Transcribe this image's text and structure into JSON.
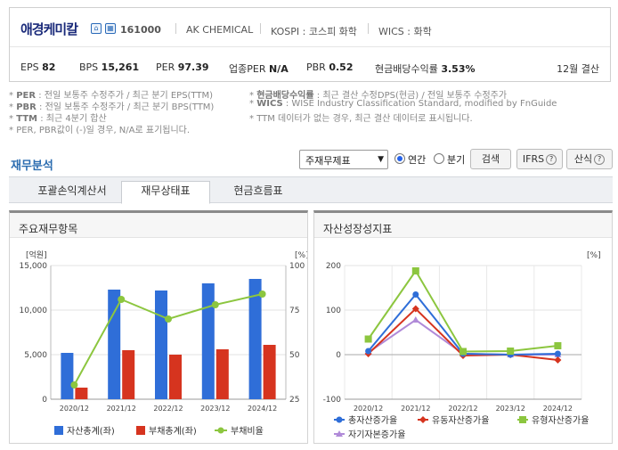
{
  "company": {
    "name": "애경케미칼",
    "code": "161000",
    "icon1": "home-icon",
    "icon2": "building-icon",
    "english_name": "AK CHEMICAL",
    "market": "KOSPI : 코스피 화학",
    "wics": "WICS : 화학"
  },
  "metrics": [
    {
      "label": "EPS",
      "value": "82"
    },
    {
      "label": "BPS",
      "value": "15,261"
    },
    {
      "label": "PER",
      "value": "97.39"
    },
    {
      "label": "업종PER",
      "value": "N/A"
    },
    {
      "label": "PBR",
      "value": "0.52"
    },
    {
      "label": "현금배당수익률",
      "value": "3.53%"
    }
  ],
  "settlement": "12월 결산",
  "notes": {
    "n1_key": "PER",
    "n1_text": ": 전일 보통주 수정주가 / 최근 분기 EPS(TTM)",
    "n2_key": "PBR",
    "n2_text": ": 전일 보통주 수정주가 / 최근 분기 BPS(TTM)",
    "n3_key": "TTM",
    "n3_text": ": 최근 4분기 합산",
    "n4_text": "PER, PBR값이 (-)일 경우, N/A로 표기됩니다.",
    "n5_key": "현금배당수익률",
    "n5_text": ": 최근 결산 수정DPS(현금) / 전일 보통주 수정주가",
    "n6_key": "WICS",
    "n6_text": ": WISE Industry Classification Standard, modified by FnGuide",
    "n7_text": "TTM 데이터가 없는 경우, 최근 결산 데이터로 표시됩니다."
  },
  "section": {
    "title": "재무분석",
    "select_value": "주재무제표",
    "radio_annual": "연간",
    "radio_quarter": "분기",
    "search_button": "검색",
    "ifrs_button": "IFRS",
    "formula_button": "산식"
  },
  "tabs": [
    {
      "label": "포괄손익계산서"
    },
    {
      "label": "재무상태표"
    },
    {
      "label": "현금흐름표"
    }
  ],
  "colors": {
    "blue": "#2f6ed8",
    "red": "#d6341f",
    "green": "#8cc63f",
    "purple": "#b08ad8"
  },
  "chart_data": [
    {
      "type": "bar",
      "title": "주요재무항목",
      "unit_left": "[억원]",
      "unit_right": "[%]",
      "categories": [
        "2020/12",
        "2021/12",
        "2022/12",
        "2023/12",
        "2024/12"
      ],
      "ylim_left": [
        0,
        15000
      ],
      "yticks_left": [
        "0",
        "5,000",
        "10,000",
        "15,000"
      ],
      "ylim_right": [
        25,
        100
      ],
      "yticks_right": [
        "25",
        "50",
        "75",
        "100"
      ],
      "series": [
        {
          "name": "자산총계(좌)",
          "kind": "bar",
          "values": [
            5200,
            12300,
            12200,
            13000,
            13500
          ]
        },
        {
          "name": "부채총계(좌)",
          "kind": "bar",
          "values": [
            1300,
            5500,
            5000,
            5600,
            6100
          ]
        },
        {
          "name": "부채비율",
          "kind": "line",
          "values": [
            33,
            81,
            70,
            78,
            84
          ]
        }
      ]
    },
    {
      "type": "line",
      "title": "자산성장성지표",
      "unit_right": "[%]",
      "categories": [
        "2020/12",
        "2021/12",
        "2022/12",
        "2023/12",
        "2024/12"
      ],
      "ylim": [
        -100,
        200
      ],
      "yticks": [
        "-100",
        "0",
        "100",
        "200"
      ],
      "series": [
        {
          "name": "총자산증가율",
          "values": [
            8,
            135,
            2,
            0,
            2
          ]
        },
        {
          "name": "유동자산증가율",
          "values": [
            2,
            103,
            -2,
            0,
            -12
          ]
        },
        {
          "name": "유형자산증가율",
          "values": [
            35,
            188,
            7,
            8,
            20
          ]
        },
        {
          "name": "자기자본증가율",
          "values": [
            5,
            78,
            2,
            0,
            0
          ]
        }
      ]
    }
  ]
}
